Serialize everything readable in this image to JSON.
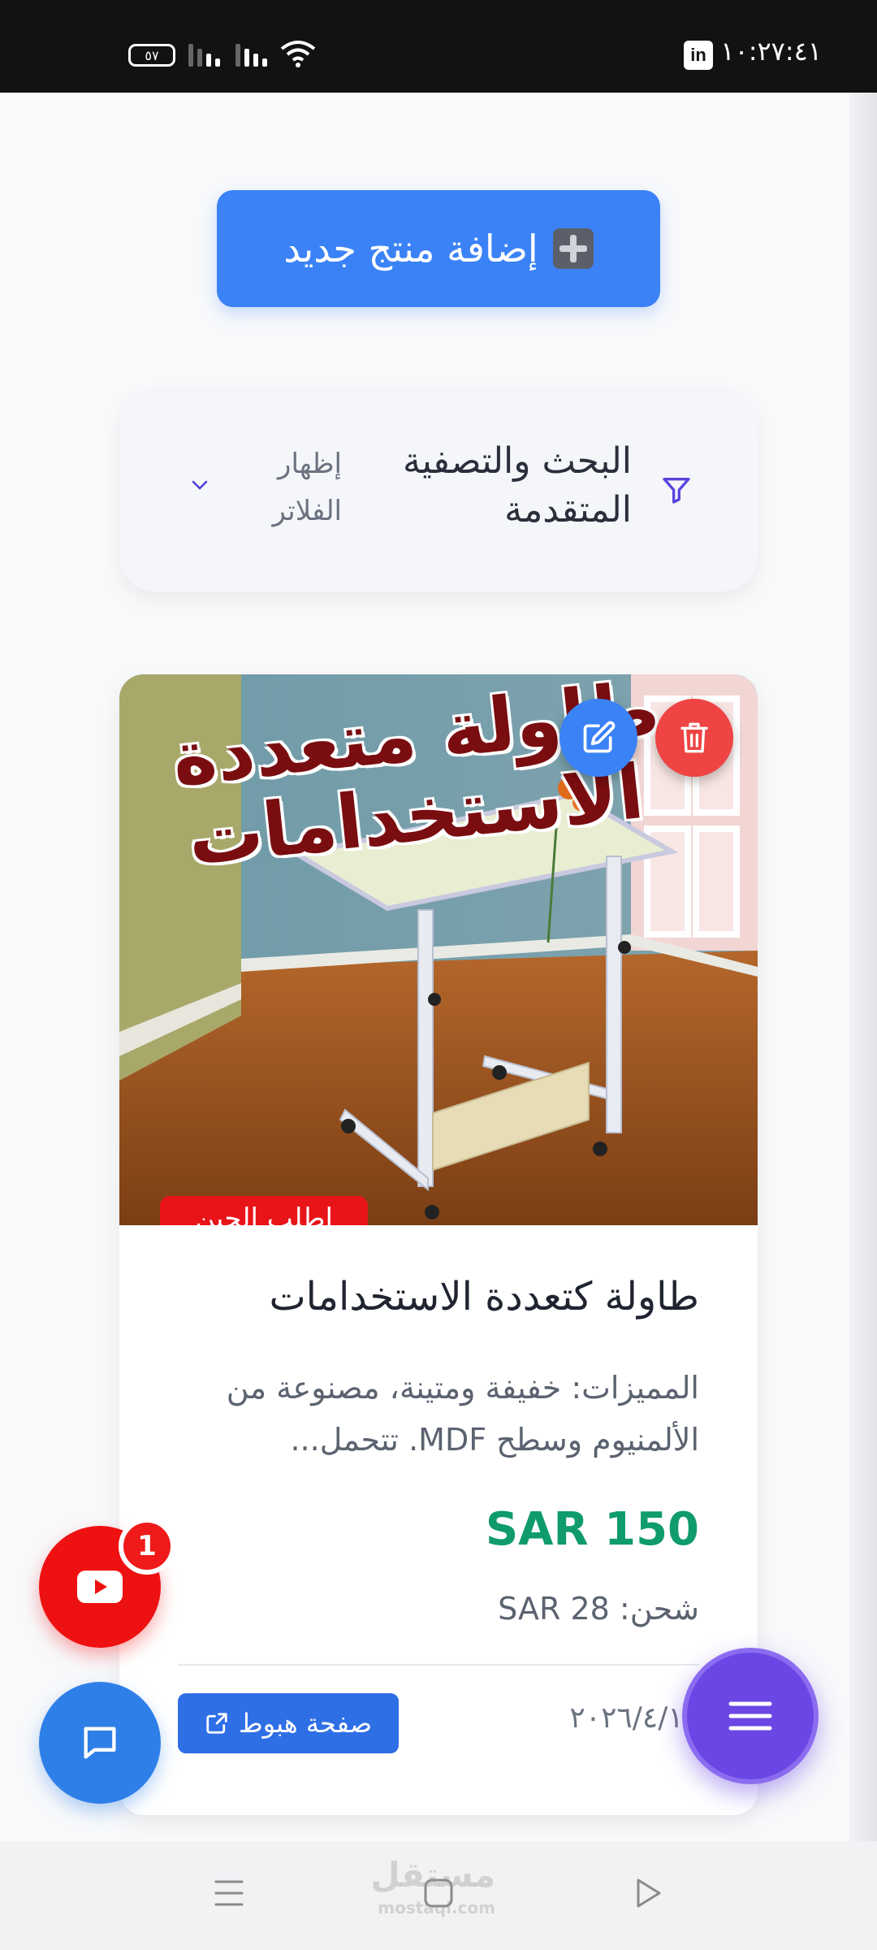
{
  "status_bar": {
    "time": "١٠:٢٧:٤١",
    "app_icon_label": "in",
    "battery": "٥٧"
  },
  "toolbar": {
    "add_product_label": "إضافة منتج جديد"
  },
  "filters": {
    "title": "البحث والتصفية المتقدمة",
    "toggle_label": "إظهار الفلاتر"
  },
  "product": {
    "image_text_line1": "طاولة متعددة",
    "image_text_line2": "الاستخدامات",
    "promo_badge": "اطلب الحين",
    "title": "طاولة كتعددة الاستخدامات",
    "description": "المميزات: خفيفة ومتينة، مصنوعة من الألمنيوم وسطح MDF. تتحمل...",
    "price": "SAR 150",
    "shipping": "شحن: SAR 28",
    "date": "٢٠٢٦/٤/١٢",
    "landing_button_label": "صفحة هبوط"
  },
  "floating": {
    "youtube_badge_count": "1"
  },
  "watermark": {
    "ar": "مستقل",
    "en": "mostaql.com"
  },
  "colors": {
    "primary": "#3b82f6",
    "danger": "#ef4444",
    "price": "#0f9b6c",
    "menu_fab": "#6b46e5"
  }
}
